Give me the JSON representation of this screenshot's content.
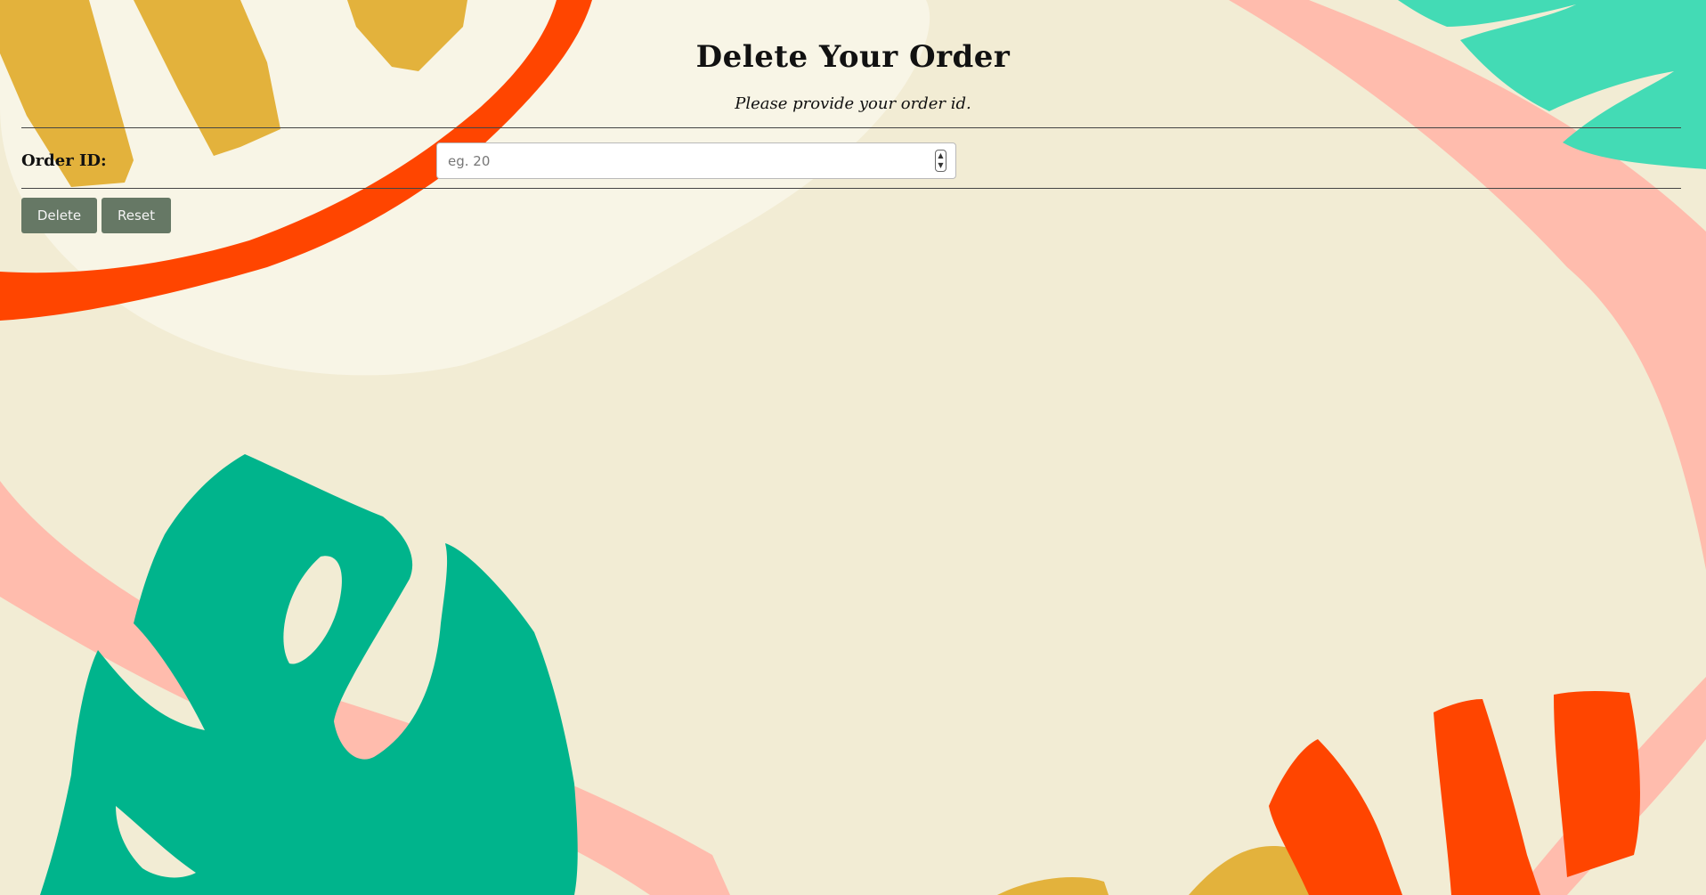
{
  "page": {
    "title": "Delete Your Order",
    "subtitle": "Please provide your order id."
  },
  "form": {
    "order_id_label": "Order ID:",
    "order_id_placeholder": "eg. 20",
    "order_id_value": "",
    "spinner_up_icon": "chevron-up-icon",
    "spinner_down_icon": "chevron-down-icon"
  },
  "buttons": {
    "delete_label": "Delete",
    "reset_label": "Reset"
  },
  "colors": {
    "background": "#f2ecd4",
    "button": "#667865",
    "leaf_green": "#00b48c",
    "mint": "#43dbb5",
    "orange_red": "#ff4500",
    "mustard": "#e3b23c",
    "salmon": "#ffbcad",
    "cream": "#f8f5e6"
  }
}
